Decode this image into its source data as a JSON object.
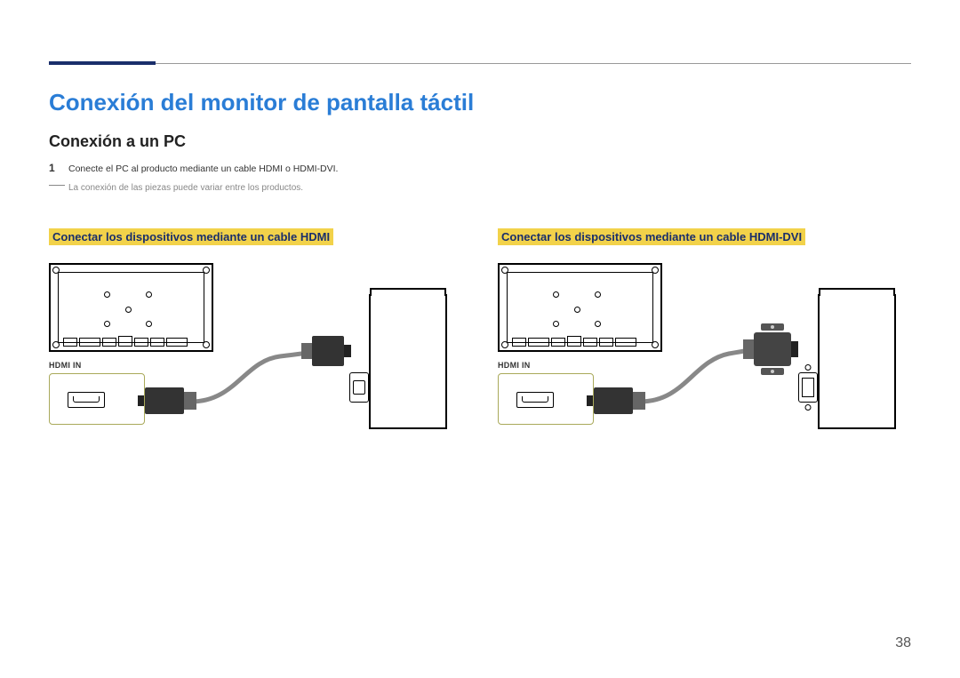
{
  "page_number": "38",
  "title": "Conexión del monitor de pantalla táctil",
  "subtitle": "Conexión a un PC",
  "step": {
    "num": "1",
    "text": "Conecte el PC al producto mediante un cable HDMI o HDMI-DVI."
  },
  "note": "La conexión de las piezas puede variar entre los productos.",
  "left": {
    "heading": "Conectar los dispositivos mediante un cable HDMI",
    "port_label": "HDMI IN"
  },
  "right": {
    "heading": "Conectar los dispositivos mediante un cable HDMI-DVI",
    "port_label": "HDMI IN"
  }
}
